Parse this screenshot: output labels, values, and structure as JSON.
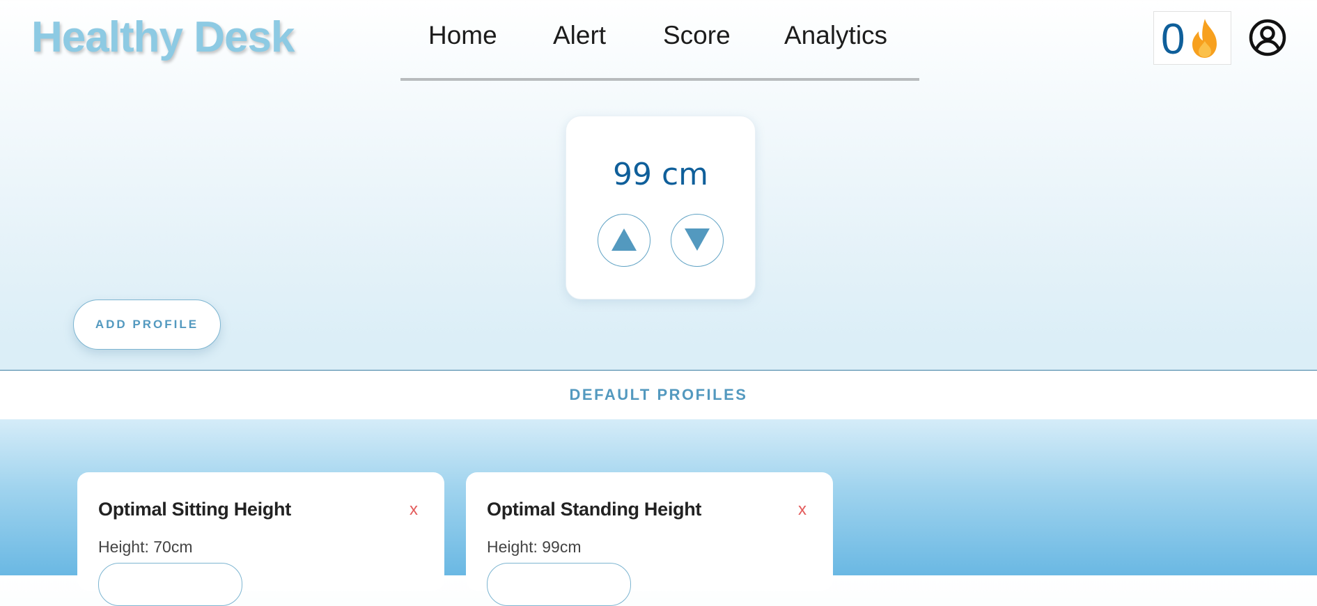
{
  "app": {
    "title": "Healthy Desk"
  },
  "nav": {
    "items": [
      "Home",
      "Alert",
      "Score",
      "Analytics"
    ]
  },
  "streak": {
    "count": "0",
    "icon": "flame-icon"
  },
  "account": {
    "icon": "account-circle-icon"
  },
  "desk": {
    "height": "99 cm",
    "up_icon": "arrow-up-icon",
    "down_icon": "arrow-down-icon"
  },
  "actions": {
    "add_profile": "ADD PROFILE"
  },
  "section": {
    "title": "DEFAULT PROFILES"
  },
  "profiles": [
    {
      "name": "Optimal Sitting Height",
      "height": "Height: 70cm",
      "close": "x"
    },
    {
      "name": "Optimal Standing Height",
      "height": "Height: 99cm",
      "close": "x"
    }
  ],
  "colors": {
    "brand": "#8dcae3",
    "accent": "#5399bf",
    "value_blue": "#0f5f9a",
    "flame": "#f7a01e",
    "close_red": "#e35b5b"
  }
}
